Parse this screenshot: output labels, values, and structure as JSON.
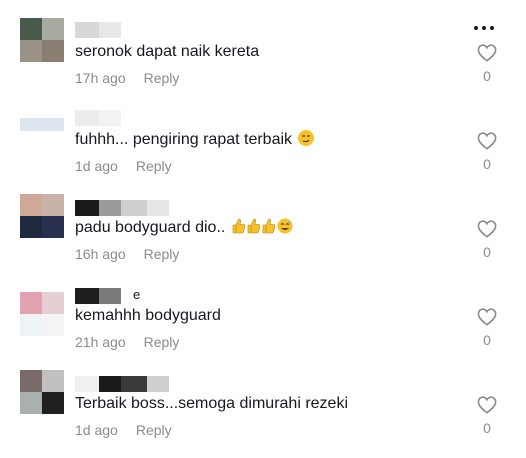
{
  "header": {
    "more_icon": "more-dots-icon"
  },
  "comments": [
    {
      "text": "seronok dapat naik kereta",
      "emoji": "",
      "time": "17h ago",
      "reply": "Reply",
      "likes": "0",
      "username_suffix": "",
      "avatar_colors": [
        "#4a5a4a",
        "#a8aca0",
        "#9a9286",
        "#8a7e72"
      ],
      "name_blocks": [
        "#d8d8d8",
        "#e8e8e8"
      ]
    },
    {
      "text": "fuhhh... pengiring rapat terbaik",
      "emoji": "smirk-emoji-icon",
      "time": "1d ago",
      "reply": "Reply",
      "likes": "0",
      "username_suffix": "",
      "avatar_colors": [
        "#dde6ee",
        "#dde6ee",
        "#ffffff",
        "#ffffff"
      ],
      "name_blocks": [
        "#ececec",
        "#f2f2f2"
      ]
    },
    {
      "text": "padu bodyguard dio..",
      "emoji": "thumbs-and-sweat-emoji-icon",
      "time": "16h ago",
      "reply": "Reply",
      "likes": "0",
      "username_suffix": "",
      "avatar_colors": [
        "#d0a898",
        "#c7b3a8",
        "#1e2a40",
        "#2a3050"
      ],
      "name_blocks": [
        "#1a1a1a",
        "#9a9a9a",
        "#cfcfcf",
        "#e6e6e6"
      ]
    },
    {
      "text": "kemahhh bodyguard",
      "emoji": "",
      "time": "21h ago",
      "reply": "Reply",
      "likes": "0",
      "username_suffix": "e",
      "avatar_colors": [
        "#e2a2b0",
        "#e6cfd2",
        "#eef3f6",
        "#f4f4f4"
      ],
      "name_blocks": [
        "#1e1e1e",
        "#7a7a7a"
      ]
    },
    {
      "text": "Terbaik boss...semoga dimurahi rezeki",
      "emoji": "",
      "time": "1d ago",
      "reply": "Reply",
      "likes": "0",
      "username_suffix": "",
      "avatar_colors": [
        "#7a6a6a",
        "#c0c0c0",
        "#a8b0b0",
        "#202020"
      ],
      "name_blocks": [
        "#f0f0f0",
        "#1a1a1a",
        "#3a3a3a",
        "#cfcfcf"
      ]
    }
  ]
}
